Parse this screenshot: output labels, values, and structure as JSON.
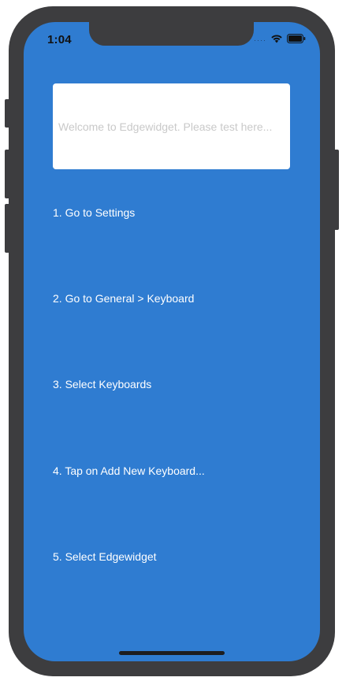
{
  "status_bar": {
    "time": "1:04",
    "signal_icon": "cellular-dots-icon",
    "wifi_icon": "wifi-icon",
    "battery_icon": "battery-icon"
  },
  "test_input": {
    "placeholder": "Welcome to Edgewidget. Please test here...",
    "value": ""
  },
  "steps": [
    {
      "label": "1. Go to Settings"
    },
    {
      "label": "2. Go to General > Keyboard"
    },
    {
      "label": "3. Select Keyboards"
    },
    {
      "label": "4. Tap on Add New Keyboard..."
    },
    {
      "label": "5. Select Edgewidget"
    }
  ],
  "colors": {
    "background": "#2f7cd1",
    "device_frame": "#3d3d3f",
    "step_text": "#ffffff",
    "placeholder_text": "#c9c9c9"
  }
}
